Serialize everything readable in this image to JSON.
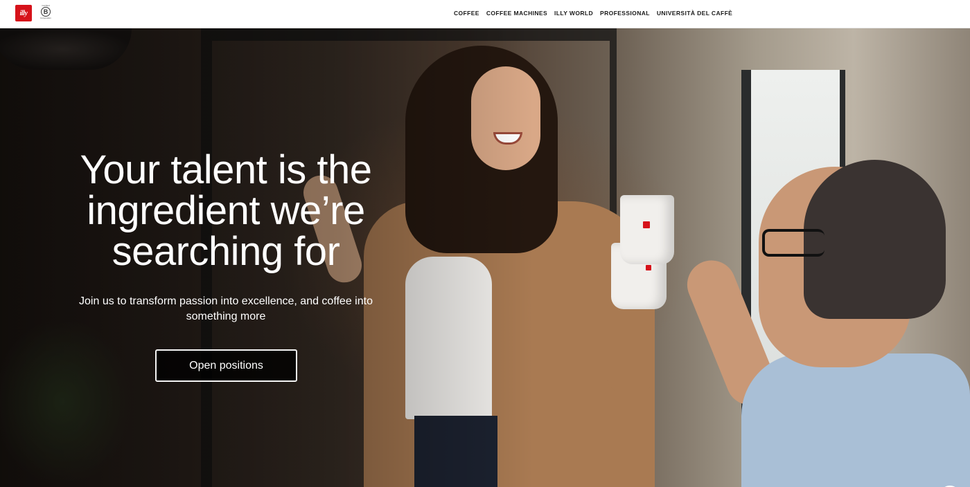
{
  "header": {
    "logo_text": "illy",
    "bcorp": {
      "top": "Certified",
      "mark": "B",
      "bottom": "Corporation"
    },
    "nav": [
      {
        "label": "COFFEE"
      },
      {
        "label": "COFFEE MACHINES"
      },
      {
        "label": "ILLY WORLD"
      },
      {
        "label": "PROFESSIONAL"
      },
      {
        "label": "UNIVERSITÀ DEL CAFFÈ"
      }
    ]
  },
  "hero": {
    "headline": "Your talent is the ingredient we’re searching for",
    "subline": "Join us to transform passion into excellence, and coffee into something more",
    "cta_label": "Open positions"
  },
  "accessibility": {
    "icon": "accessibility-icon",
    "glyph": "♿"
  },
  "colors": {
    "brand_red": "#d6121a",
    "accessibility_red": "#d93a2b",
    "header_bg": "#ffffff",
    "hero_text": "#ffffff"
  }
}
